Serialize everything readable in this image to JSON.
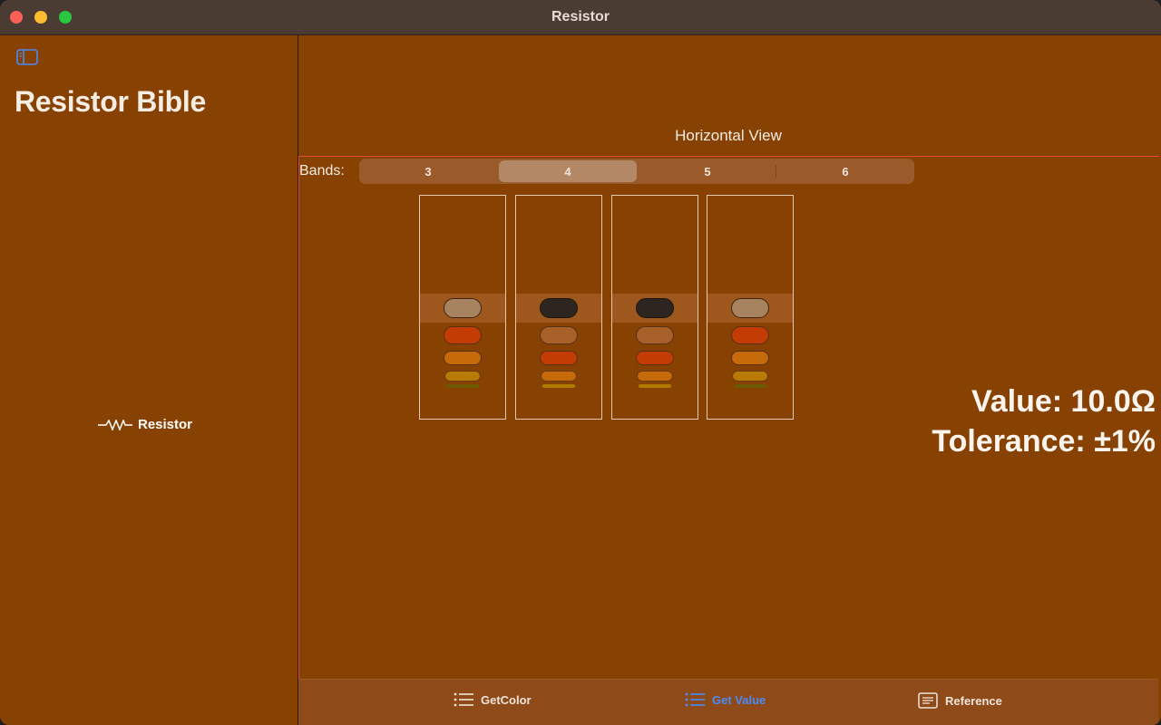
{
  "window": {
    "title": "Resistor"
  },
  "sidebar": {
    "title": "Resistor Bible",
    "items": [
      {
        "label": "Resistor",
        "icon": "resistor-symbol-icon"
      }
    ]
  },
  "main": {
    "nav_title": "Horizontal View",
    "bands_label": "Bands:",
    "band_options": [
      "3",
      "4",
      "5",
      "6"
    ],
    "band_selected": "4",
    "value_text": "Value: 10.0Ω",
    "tolerance_text": "Tolerance: ±1%"
  },
  "colors": {
    "background": "#874100",
    "brown": "#a8835f",
    "black": "#2d2520",
    "red": "#c23c04",
    "orange": "#c66a0a",
    "selection_accent": "#4b8bf6"
  },
  "wheels": [
    {
      "selected": "brown"
    },
    {
      "selected": "black"
    },
    {
      "selected": "black"
    },
    {
      "selected": "brown"
    }
  ],
  "tabbar": {
    "tabs": [
      {
        "label": "GetColor",
        "icon": "list-icon"
      },
      {
        "label": "Get Value",
        "icon": "list-icon",
        "active": true
      },
      {
        "label": "Reference",
        "icon": "document-icon"
      }
    ]
  }
}
